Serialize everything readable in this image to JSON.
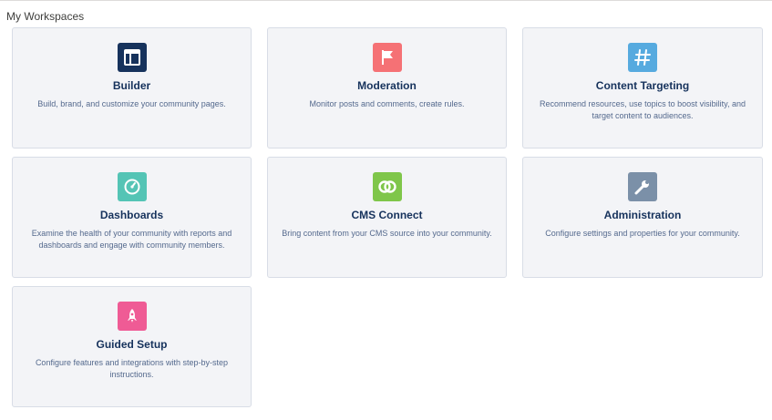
{
  "section": {
    "title": "My Workspaces"
  },
  "tiles": [
    {
      "title": "Builder",
      "desc": "Build, brand, and customize your community pages.",
      "icon": "builder-icon",
      "color": "#16325c"
    },
    {
      "title": "Moderation",
      "desc": "Monitor posts and comments, create rules.",
      "icon": "flag-icon",
      "color": "#f57175"
    },
    {
      "title": "Content Targeting",
      "desc": "Recommend resources, use topics to boost visibility, and target content to audiences.",
      "icon": "hashtag-icon",
      "color": "#56aadf"
    },
    {
      "title": "Dashboards",
      "desc": "Examine the health of your community with reports and dashboards and engage with community members.",
      "icon": "gauge-icon",
      "color": "#54c4b5"
    },
    {
      "title": "CMS Connect",
      "desc": "Bring content from your CMS source into your community.",
      "icon": "link-rings-icon",
      "color": "#7fc64a"
    },
    {
      "title": "Administration",
      "desc": "Configure settings and properties for your community.",
      "icon": "wrench-icon",
      "color": "#7b90a8"
    },
    {
      "title": "Guided Setup",
      "desc": "Configure features and integrations with step-by-step instructions.",
      "icon": "rocket-icon",
      "color": "#ef5b95"
    }
  ]
}
